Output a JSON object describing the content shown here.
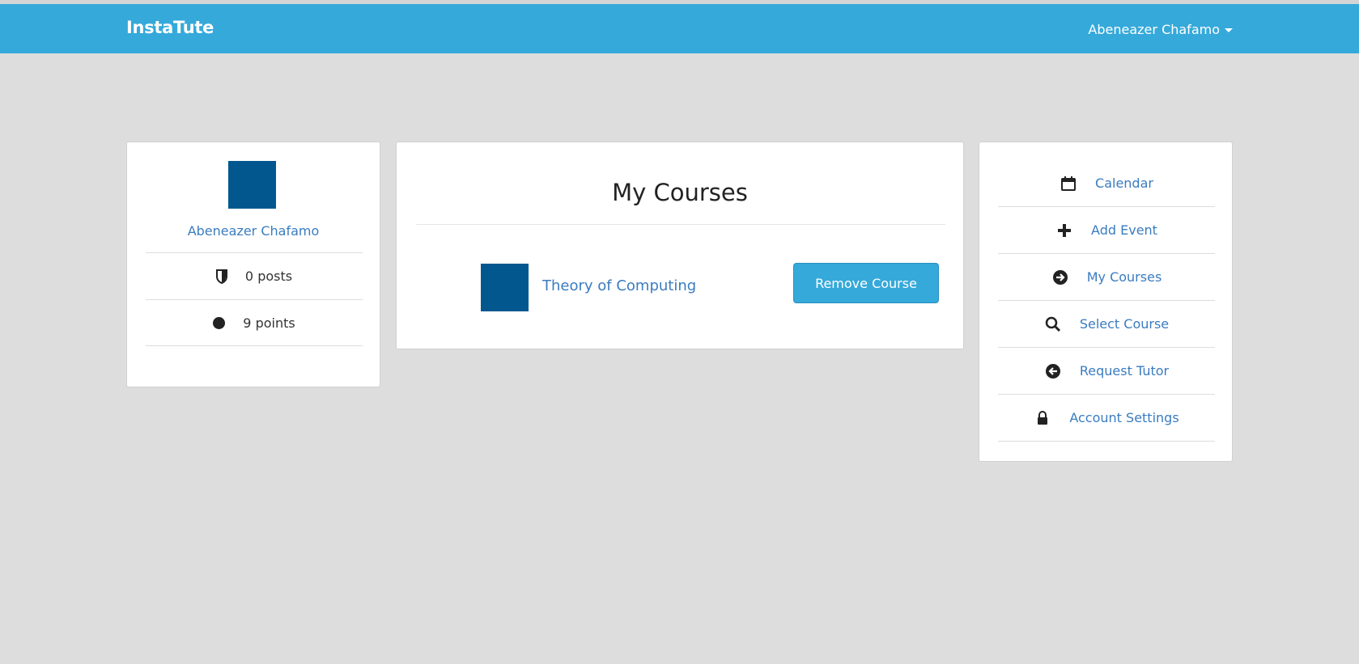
{
  "navbar": {
    "brand": "InstaTute",
    "user_name": "Abeneazer Chafamo"
  },
  "profile": {
    "name": "Abeneazer Chafamo",
    "posts": "0 posts",
    "points": "9 points"
  },
  "courses": {
    "title": "My Courses",
    "items": [
      {
        "name": "Theory of Computing",
        "action_label": "Remove Course"
      }
    ]
  },
  "menu": {
    "items": [
      {
        "label": "Calendar",
        "icon": "calendar-icon"
      },
      {
        "label": "Add Event",
        "icon": "plus-icon"
      },
      {
        "label": "My Courses",
        "icon": "arrow-right-circle-icon"
      },
      {
        "label": "Select Course",
        "icon": "search-icon"
      },
      {
        "label": "Request Tutor",
        "icon": "arrow-left-circle-icon"
      },
      {
        "label": "Account Settings",
        "icon": "lock-icon"
      }
    ]
  },
  "colors": {
    "navbar": "#35a9da",
    "link": "#3a7cc0",
    "avatar": "#02578f",
    "background": "#dddddd"
  }
}
